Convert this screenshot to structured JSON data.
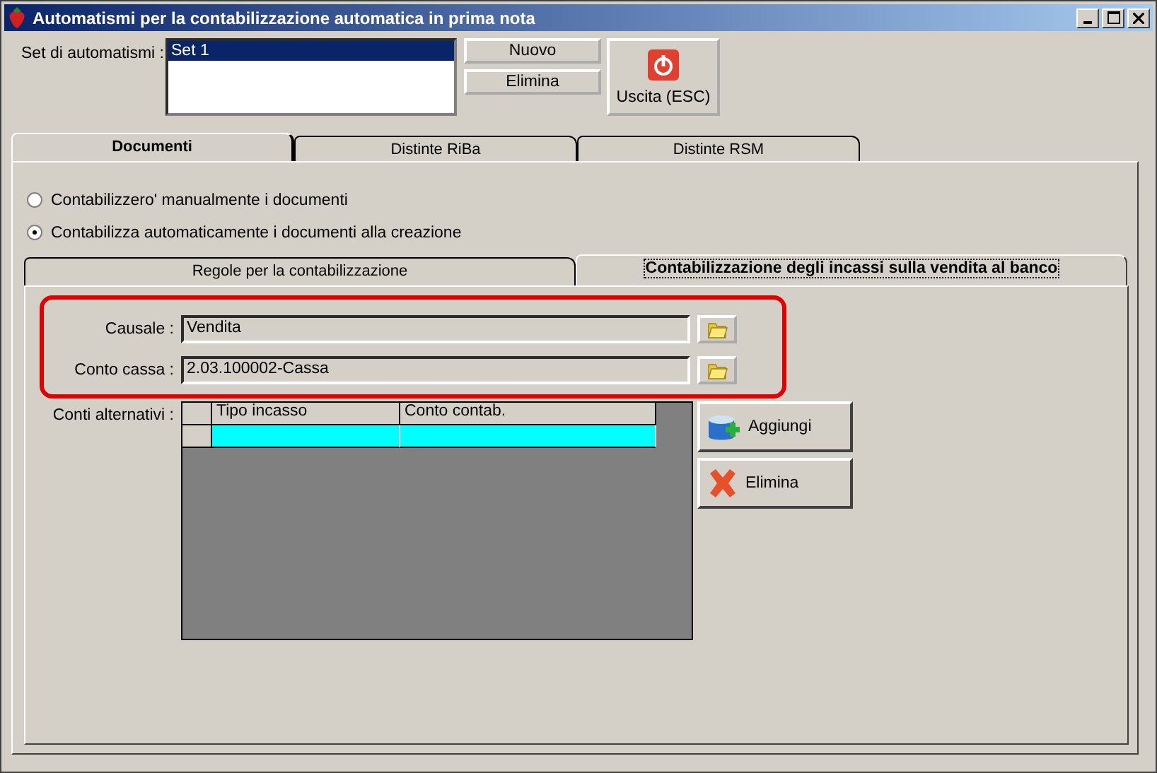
{
  "window": {
    "title": "Automatismi per la contabilizzazione automatica in prima nota"
  },
  "automation_sets": {
    "label": "Set di automatismi :",
    "items": [
      {
        "label": "Set 1",
        "selected": true
      }
    ]
  },
  "set_buttons": [
    "Nuovo",
    "Elimina"
  ],
  "exit_button": "Uscita (ESC)",
  "tabs": [
    {
      "label": "Documenti",
      "selected": true
    },
    {
      "label": "Distinte RiBa",
      "selected": false
    },
    {
      "label": "Distinte RSM",
      "selected": false
    }
  ],
  "posting_modes": [
    {
      "label": "Contabilizzero' manualmente i documenti",
      "selected": false
    },
    {
      "label": "Contabilizza automaticamente i documenti alla creazione",
      "selected": true
    }
  ],
  "sub_tabs": [
    {
      "label": "Regole per la contabilizzazione",
      "selected": false
    },
    {
      "label": "Contabilizzazione degli incassi sulla vendita al banco",
      "selected": true
    }
  ],
  "fields": [
    {
      "label": "Causale :",
      "value": "Vendita"
    },
    {
      "label": "Conto cassa :",
      "value": "2.03.100002-Cassa"
    }
  ],
  "alternatives": {
    "label": "Conti alternativi :",
    "columns": [
      "Tipo incasso",
      "Conto contab."
    ],
    "blank_rows": [
      {
        "selected": true
      }
    ]
  },
  "grid_buttons": [
    {
      "label": "Aggiungi",
      "kind": "add"
    },
    {
      "label": "Elimina",
      "kind": "delete"
    }
  ]
}
